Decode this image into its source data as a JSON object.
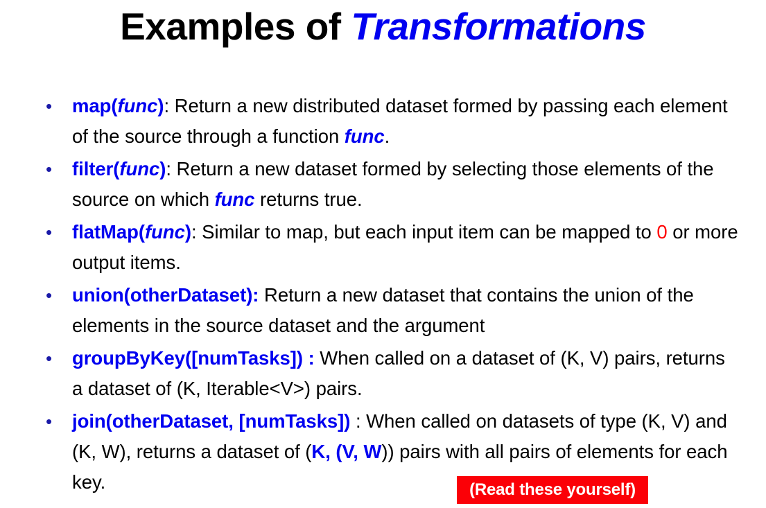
{
  "slide": {
    "title": {
      "plain": "Examples of ",
      "accent": "Transformations"
    },
    "bullet_marker": "•",
    "bullets": [
      {
        "id": "map",
        "marker": "•",
        "api_name": "map(",
        "api_arg": "func",
        "api_close": ")",
        "body_1": ": Return a new distributed dataset formed by passing each element of the source through a function ",
        "inline_arg": "func",
        "body_2": ".",
        "full_text": "map(func): Return a new distributed dataset formed by passing each element of the source through a function func."
      },
      {
        "id": "filter",
        "marker": "•",
        "api_name": "filter(",
        "api_arg": "func",
        "api_close": ")",
        "body_1": ": Return a new dataset formed by selecting those elements of the source on which ",
        "inline_arg": "func",
        "body_2": " returns true.",
        "full_text": "filter(func): Return a new dataset formed by selecting those elements of the source on which func returns true."
      },
      {
        "id": "flatMap",
        "marker": "•",
        "api_name": "flatMap(",
        "api_arg": "func",
        "api_close": ")",
        "body_1": ": Similar to map, but each input item can be mapped to ",
        "highlight": "0",
        "body_2": " or more output items.",
        "full_text": "flatMap(func): Similar to map, but each input item can be mapped to 0 or more output items."
      },
      {
        "id": "union",
        "marker": "•",
        "api_name": "union(otherDataset):",
        "body_1": " Return a new dataset that contains the union of the elements in the source dataset and the argument",
        "full_text": "union(otherDataset): Return a new dataset that contains the union of the elements in the source dataset and the argument"
      },
      {
        "id": "groupByKey",
        "marker": "•",
        "api_name": "groupByKey([numTasks]) :",
        "body_1": " When called on a dataset of (K, V) pairs, returns a dataset of (K, Iterable<V>) pairs.",
        "full_text": "groupByKey([numTasks]) : When called on a dataset of (K, V) pairs, returns a dataset of (K, Iterable<V>) pairs."
      },
      {
        "id": "join",
        "marker": "•",
        "api_name": "join(otherDataset, [numTasks])",
        "body_1": " : When called on datasets of type (K, V) and (K, W), returns a dataset of (",
        "highlight": "K, (V, W",
        "body_2": ")) pairs with all pairs of elements for each key.",
        "full_text": "join(otherDataset, [numTasks]) : When called on datasets of type (K, V) and (K, W), returns a dataset of (K, (V, W)) pairs with all pairs of elements for each key."
      }
    ],
    "callout": {
      "label": "(Read these yourself)",
      "background_color": "#fb0007",
      "text_color": "#ffffff"
    },
    "colors": {
      "accent_blue": "#0000f0",
      "highlight_red": "#ff0000",
      "body_black": "#000000",
      "background": "#ffffff"
    }
  }
}
